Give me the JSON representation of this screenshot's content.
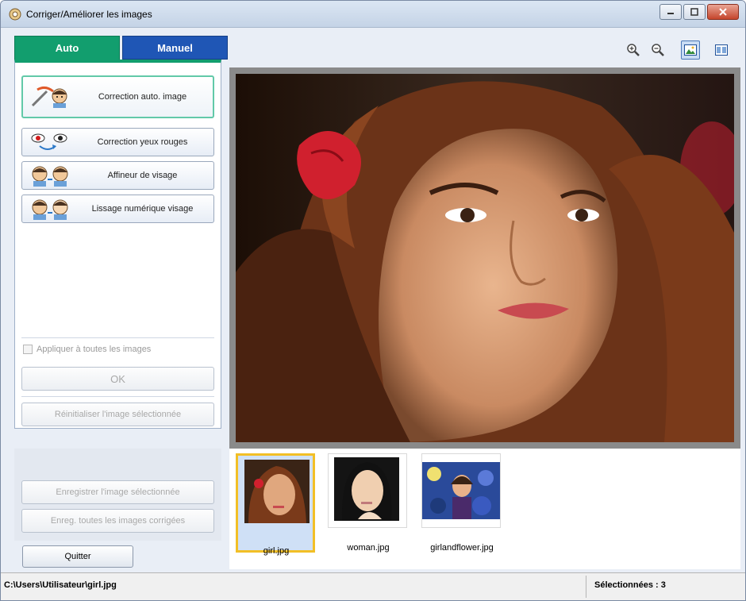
{
  "window": {
    "title": "Corriger/Améliorer les images"
  },
  "tabs": [
    {
      "label": "Auto"
    },
    {
      "label": "Manuel"
    }
  ],
  "auto_panel": {
    "buttons": [
      {
        "label": "Correction auto. image",
        "icon": "auto-correct-icon"
      },
      {
        "label": "Correction yeux rouges",
        "icon": "red-eye-icon"
      },
      {
        "label": "Affineur de visage",
        "icon": "face-sharpen-icon"
      },
      {
        "label": "Lissage numérique visage",
        "icon": "face-smooth-icon"
      }
    ],
    "apply_all_label": "Appliquer à toutes les images",
    "ok_label": "OK",
    "reset_label": "Réinitialiser l'image sélectionnée"
  },
  "lower_panel": {
    "save_selected_label": "Enregistrer l'image sélectionnée",
    "save_all_label": "Enreg. toutes les images corrigées",
    "quit_label": "Quitter"
  },
  "toolbar": {
    "icons": [
      "zoom-in-icon",
      "zoom-out-icon",
      "full-image-icon",
      "compare-icon"
    ]
  },
  "thumbnails": [
    {
      "name": "girl.jpg",
      "selected": true
    },
    {
      "name": "woman.jpg",
      "selected": false
    },
    {
      "name": "girlandflower.jpg",
      "selected": false
    }
  ],
  "status": {
    "path": "C:\\Users\\Utilisateur\\girl.jpg",
    "selected": "Sélectionnées : 3"
  },
  "colors": {
    "auto_tab": "#129e6e",
    "manuel_tab": "#1f56b5",
    "selection": "#f2bf26"
  }
}
